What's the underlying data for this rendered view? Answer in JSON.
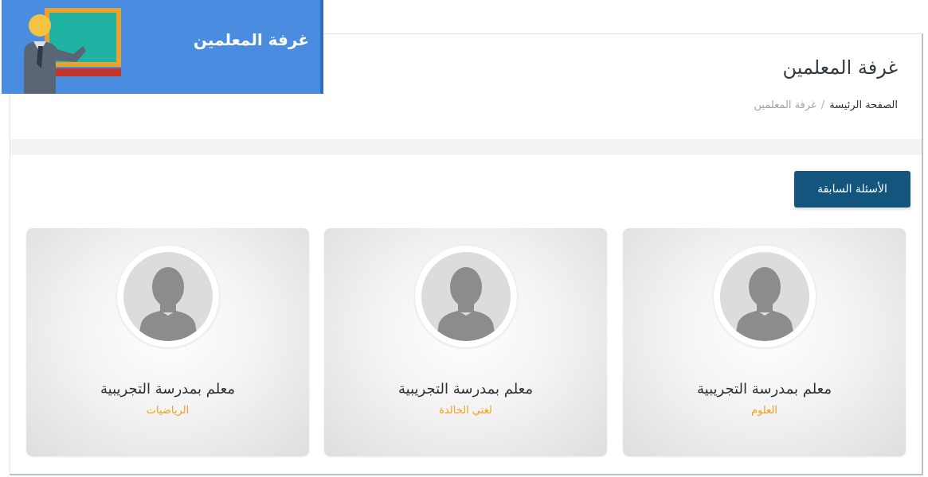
{
  "banner": {
    "title": "غرفة المعلمين"
  },
  "header": {
    "title": "غرفة المعلمين",
    "breadcrumb": {
      "home": "الصفحة الرئيسة",
      "separator": "/",
      "current": "غرفة المعلمين"
    }
  },
  "actions": {
    "previous_questions_label": "الأسئلة السابقة"
  },
  "teachers": [
    {
      "name": "معلم بمدرسة التجريبية",
      "subject": "العلوم"
    },
    {
      "name": "معلم بمدرسة التجريبية",
      "subject": "لغتي الخالدة"
    },
    {
      "name": "معلم بمدرسة التجريبية",
      "subject": "الرياضيات"
    }
  ],
  "colors": {
    "banner_bg": "#4a8ce0",
    "button_bg": "#13557d",
    "subject_text": "#f0a11a"
  }
}
